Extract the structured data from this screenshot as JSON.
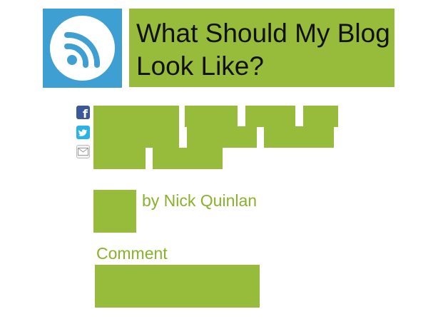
{
  "post": {
    "title": "What Should My Blog Look Like?",
    "byline": "by Nick Quinlan"
  },
  "comments": {
    "label": "Comment"
  },
  "share": {
    "services": [
      "facebook",
      "twitter",
      "email"
    ],
    "icons": [
      "facebook-icon",
      "twitter-icon",
      "email-icon"
    ]
  },
  "logo": {
    "icon": "rss-icon"
  },
  "colors": {
    "accent_green": "#97bb3a",
    "link_green": "#89b12a",
    "rss_blue": "#3e9fd3",
    "facebook_blue": "#3b5998",
    "twitter_blue": "#2bb3e8"
  }
}
